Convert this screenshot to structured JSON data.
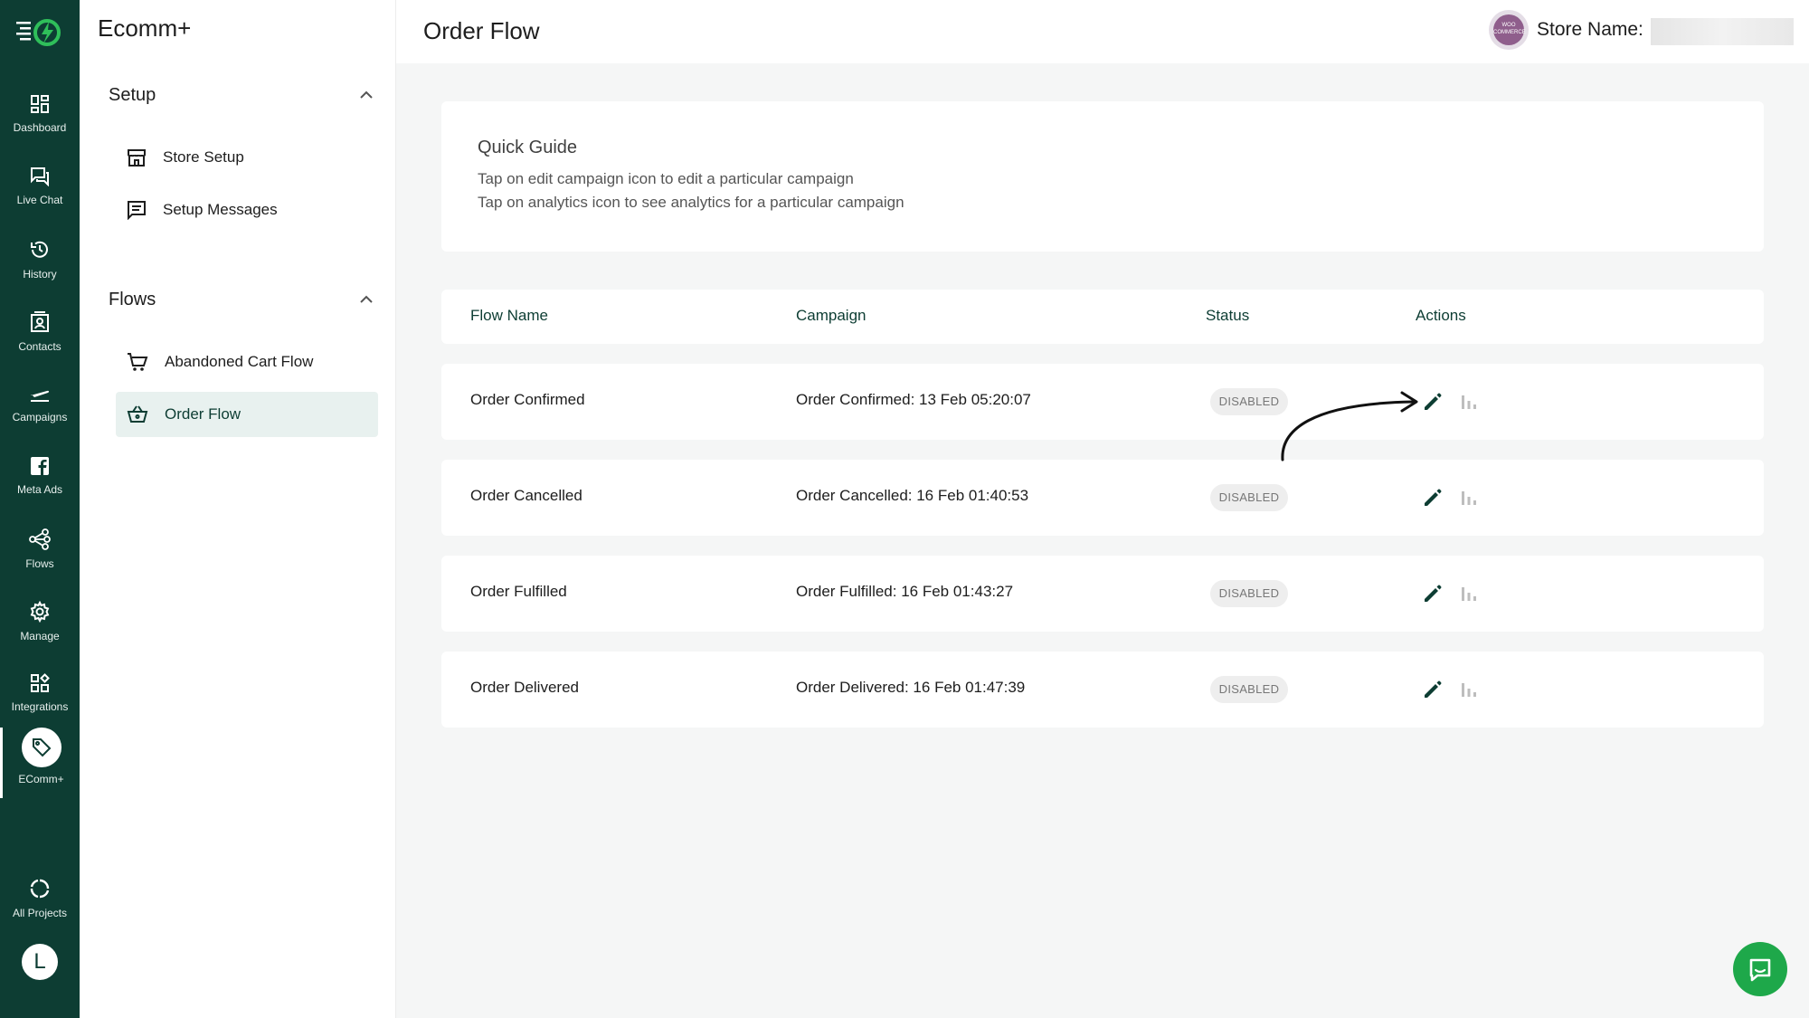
{
  "rail": {
    "items": [
      {
        "label": "Dashboard",
        "icon": "dashboard-icon"
      },
      {
        "label": "Live Chat",
        "icon": "chat-icon"
      },
      {
        "label": "History",
        "icon": "history-icon"
      },
      {
        "label": "Contacts",
        "icon": "contacts-icon"
      },
      {
        "label": "Campaigns",
        "icon": "campaigns-icon"
      },
      {
        "label": "Meta Ads",
        "icon": "facebook-icon"
      },
      {
        "label": "Flows",
        "icon": "flows-icon"
      },
      {
        "label": "Manage",
        "icon": "gear-icon"
      },
      {
        "label": "Integrations",
        "icon": "integrations-icon"
      },
      {
        "label": "EComm+",
        "icon": "tag-icon"
      }
    ],
    "all_projects": "All Projects",
    "avatar_letter": "L"
  },
  "sidebar": {
    "title": "Ecomm+",
    "sections": [
      {
        "label": "Setup",
        "items": [
          {
            "label": "Store Setup"
          },
          {
            "label": "Setup Messages"
          }
        ]
      },
      {
        "label": "Flows",
        "items": [
          {
            "label": "Abandoned Cart Flow"
          },
          {
            "label": "Order Flow"
          }
        ]
      }
    ]
  },
  "header": {
    "title": "Order Flow",
    "store_label": "Store Name:",
    "store_logo_text": "WOO COMMERCE"
  },
  "guide": {
    "title": "Quick Guide",
    "lines": [
      "Tap on edit campaign icon to edit a particular campaign",
      "Tap on analytics icon to see analytics for a particular campaign"
    ]
  },
  "table": {
    "columns": [
      "Flow Name",
      "Campaign",
      "Status",
      "Actions"
    ],
    "rows": [
      {
        "flow": "Order Confirmed",
        "campaign": "Order Confirmed: 13 Feb 05:20:07",
        "status": "DISABLED"
      },
      {
        "flow": "Order Cancelled",
        "campaign": "Order Cancelled: 16 Feb 01:40:53",
        "status": "DISABLED"
      },
      {
        "flow": "Order Fulfilled",
        "campaign": "Order Fulfilled: 16 Feb 01:43:27",
        "status": "DISABLED"
      },
      {
        "flow": "Order Delivered",
        "campaign": "Order Delivered: 16 Feb 01:47:39",
        "status": "DISABLED"
      }
    ]
  },
  "colors": {
    "primary": "#0d3d33",
    "accent_green": "#1ea84a",
    "active_bg": "#e8f1ef"
  }
}
